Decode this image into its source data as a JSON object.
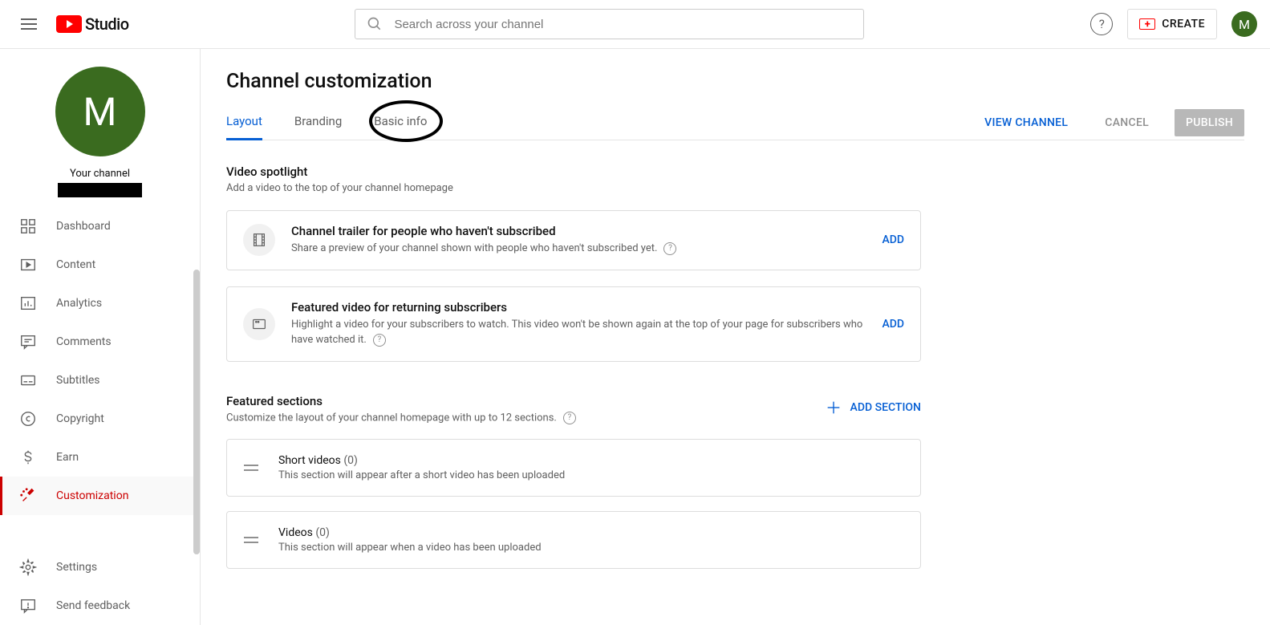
{
  "header": {
    "logo_text": "Studio",
    "search_placeholder": "Search across your channel",
    "create_label": "CREATE",
    "avatar_letter": "M"
  },
  "sidebar": {
    "channel_avatar_letter": "M",
    "channel_label": "Your channel",
    "items": [
      {
        "label": "Dashboard"
      },
      {
        "label": "Content"
      },
      {
        "label": "Analytics"
      },
      {
        "label": "Comments"
      },
      {
        "label": "Subtitles"
      },
      {
        "label": "Copyright"
      },
      {
        "label": "Earn"
      },
      {
        "label": "Customization"
      }
    ],
    "bottom": [
      {
        "label": "Settings"
      },
      {
        "label": "Send feedback"
      }
    ]
  },
  "main": {
    "page_title": "Channel customization",
    "tabs": [
      {
        "label": "Layout"
      },
      {
        "label": "Branding"
      },
      {
        "label": "Basic info"
      }
    ],
    "actions": {
      "view_channel": "VIEW CHANNEL",
      "cancel": "CANCEL",
      "publish": "PUBLISH"
    },
    "spotlight": {
      "title": "Video spotlight",
      "desc": "Add a video to the top of your channel homepage",
      "cards": [
        {
          "title": "Channel trailer for people who haven't subscribed",
          "desc": "Share a preview of your channel shown with people who haven't subscribed yet.",
          "add": "ADD"
        },
        {
          "title": "Featured video for returning subscribers",
          "desc": "Highlight a video for your subscribers to watch. This video won't be shown again at the top of your page for subscribers who have watched it.",
          "add": "ADD"
        }
      ]
    },
    "featured": {
      "title": "Featured sections",
      "desc": "Customize the layout of your channel homepage with up to 12 sections.",
      "add_section": "ADD SECTION",
      "items": [
        {
          "title": "Short videos",
          "count": "(0)",
          "desc": "This section will appear after a short video has been uploaded"
        },
        {
          "title": "Videos",
          "count": "(0)",
          "desc": "This section will appear when a video has been uploaded"
        }
      ]
    }
  }
}
